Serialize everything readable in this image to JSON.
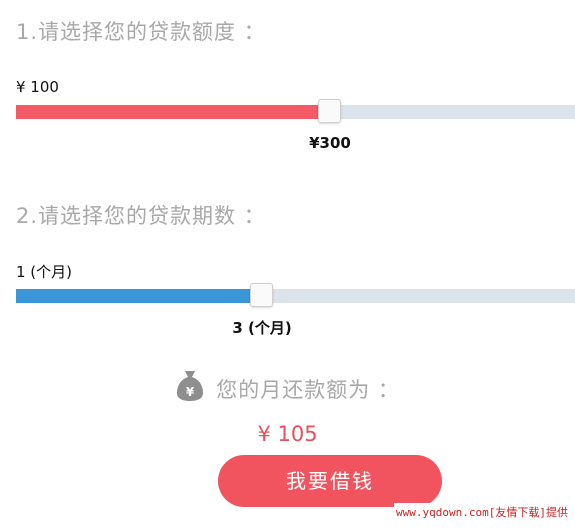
{
  "amount_section": {
    "title": "1.请选择您的贷款额度 ：",
    "min_label": "¥ 100",
    "current_label": "¥300",
    "slider_position": 0.56,
    "fill_color": "#f25a66"
  },
  "term_section": {
    "title": "2.请选择您的贷款期数 ：",
    "min_label": "1 (个月)",
    "current_label": "3 (个月)",
    "slider_position": 0.44,
    "fill_color": "#3b96d8"
  },
  "result": {
    "icon": "money-bag-icon",
    "label": "您的月还款额为 ：",
    "amount": "¥ 105"
  },
  "borrow_button": {
    "label": "我要借钱",
    "color": "#f2545f"
  },
  "watermark": "www.yqdown.com[友情下载]提供"
}
